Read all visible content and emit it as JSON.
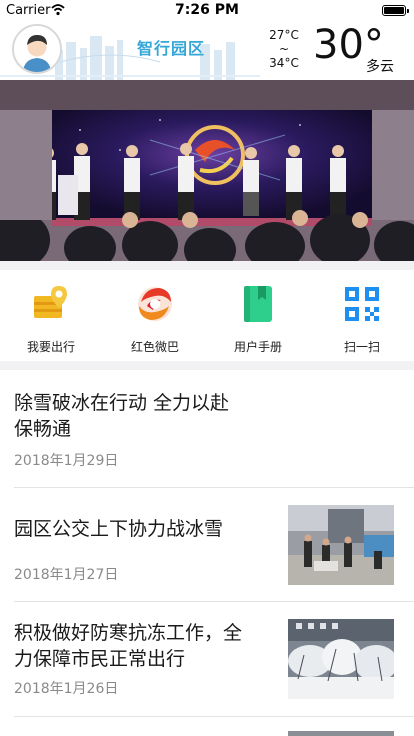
{
  "status_bar": {
    "carrier": "Carrier",
    "time": "7:26 PM"
  },
  "header": {
    "brand": "智行园区",
    "temp_high": "27°C",
    "temp_sep": "~",
    "temp_low": "34°C",
    "temp_now": "30°",
    "weather": "多云",
    "accent_color": "#35a6d8"
  },
  "quick_actions": [
    {
      "label": "我要出行",
      "icon": "bus-map-pin-icon"
    },
    {
      "label": "红色微巴",
      "icon": "red-swirl-logo-icon"
    },
    {
      "label": "用户手册",
      "icon": "green-book-icon"
    },
    {
      "label": "扫一扫",
      "icon": "qr-scan-icon"
    }
  ],
  "news": [
    {
      "title_line1": "除雪破冰在行动 全力以赴",
      "title_line2": "保畅通",
      "date": "2018年1月29日"
    },
    {
      "title_line1": "园区公交上下协力战冰雪",
      "title_line2": "",
      "date": "2018年1月27日"
    },
    {
      "title_line1": "积极做好防寒抗冻工作，全",
      "title_line2": "力保障市民正常出行",
      "date": "2018年1月26日"
    }
  ]
}
